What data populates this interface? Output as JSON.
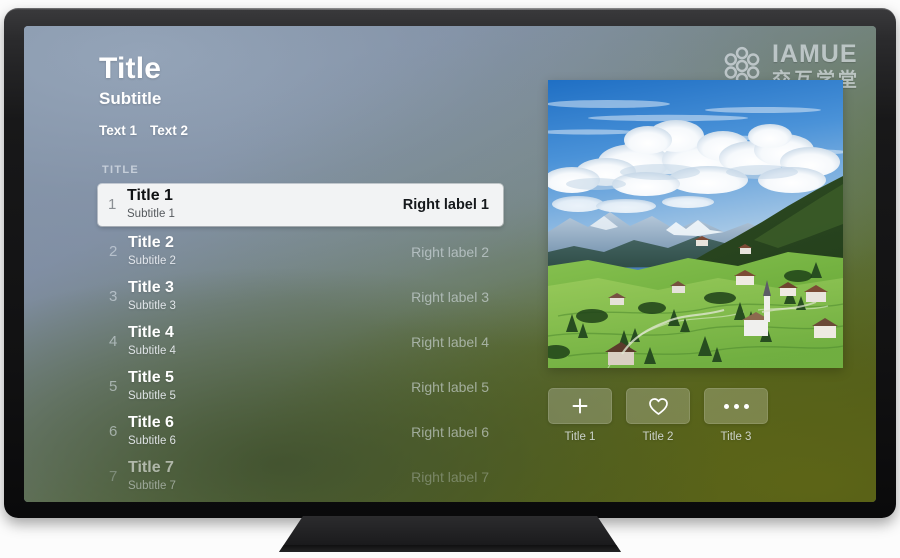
{
  "device": {
    "type": "television",
    "stand": "pedestal"
  },
  "branding": {
    "mark": "flower-rings-logo",
    "name_en": "IAMUE",
    "name_cn": "交互学堂"
  },
  "header": {
    "title": "Title",
    "subtitle": "Subtitle",
    "texts": [
      "Text 1",
      "Text 2"
    ]
  },
  "list": {
    "section_header": "TITLE",
    "rows": [
      {
        "num": "1",
        "title": "Title 1",
        "subtitle": "Subtitle 1",
        "right": "Right label 1",
        "selected": true
      },
      {
        "num": "2",
        "title": "Title 2",
        "subtitle": "Subtitle 2",
        "right": "Right label 2",
        "selected": false
      },
      {
        "num": "3",
        "title": "Title 3",
        "subtitle": "Subtitle 3",
        "right": "Right label 3",
        "selected": false
      },
      {
        "num": "4",
        "title": "Title 4",
        "subtitle": "Subtitle 4",
        "right": "Right label 4",
        "selected": false
      },
      {
        "num": "5",
        "title": "Title 5",
        "subtitle": "Subtitle 5",
        "right": "Right label 5",
        "selected": false
      },
      {
        "num": "6",
        "title": "Title 6",
        "subtitle": "Subtitle 6",
        "right": "Right label 6",
        "selected": false
      },
      {
        "num": "7",
        "title": "Title 7",
        "subtitle": "Subtitle 7",
        "right": "Right label 7",
        "selected": false
      }
    ]
  },
  "media": {
    "image_alt": "Green alpine valley with villages, forested hills, snow-capped peaks and cumulus clouds"
  },
  "actions": [
    {
      "icon": "plus-icon",
      "label": "Title 1"
    },
    {
      "icon": "heart-icon",
      "label": "Title 2"
    },
    {
      "icon": "ellipsis-icon",
      "label": "Title 3"
    }
  ],
  "colors": {
    "bg_top_left": "#7b8ca3",
    "bg_bottom_right": "#4d5316",
    "selected_row_bg": "#f2f3f4",
    "selected_row_text": "#101214",
    "bezel": "#141416",
    "text_primary": "#ffffff"
  }
}
